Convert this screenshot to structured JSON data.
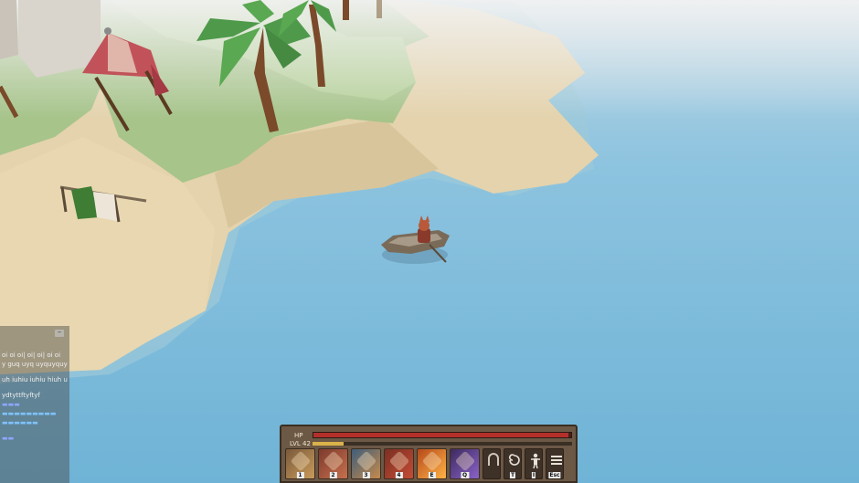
{
  "chat": {
    "minimize_label": "–",
    "lines": [
      "oi oi oi| oi| oi| oi oi",
      "y guq uyq uyquyquyo",
      "uh iuhiu iuhiu hiuh uih",
      "ydtyttftyftyf"
    ]
  },
  "hud": {
    "hp_label": "HP",
    "hp_fraction": 0.99,
    "level_label": "LVL 42",
    "xp_fraction": 0.12,
    "skills": [
      {
        "icon": "sword-icon",
        "key": "1",
        "colors": [
          "#7a5a3c",
          "#c99a5a"
        ]
      },
      {
        "icon": "slash-icon",
        "key": "2",
        "colors": [
          "#7d3a2d",
          "#c7704e"
        ]
      },
      {
        "icon": "shield-icon",
        "key": "3",
        "colors": [
          "#3f5d7a",
          "#c58a4c"
        ]
      },
      {
        "icon": "fist-icon",
        "key": "4",
        "colors": [
          "#7a2f22",
          "#c44c36"
        ]
      },
      {
        "icon": "fire-burst-icon",
        "key": "E",
        "colors": [
          "#b54a1a",
          "#ffb347"
        ]
      },
      {
        "icon": "arcane-claw-icon",
        "key": "Q",
        "colors": [
          "#3d2a5e",
          "#8a63c9"
        ]
      }
    ],
    "utility": [
      {
        "icon": "horseshoe-icon",
        "key": ""
      },
      {
        "icon": "swirl-icon",
        "key": "T"
      },
      {
        "icon": "character-icon",
        "key": "I"
      },
      {
        "icon": "menu-icon",
        "key": "Esc"
      }
    ]
  }
}
